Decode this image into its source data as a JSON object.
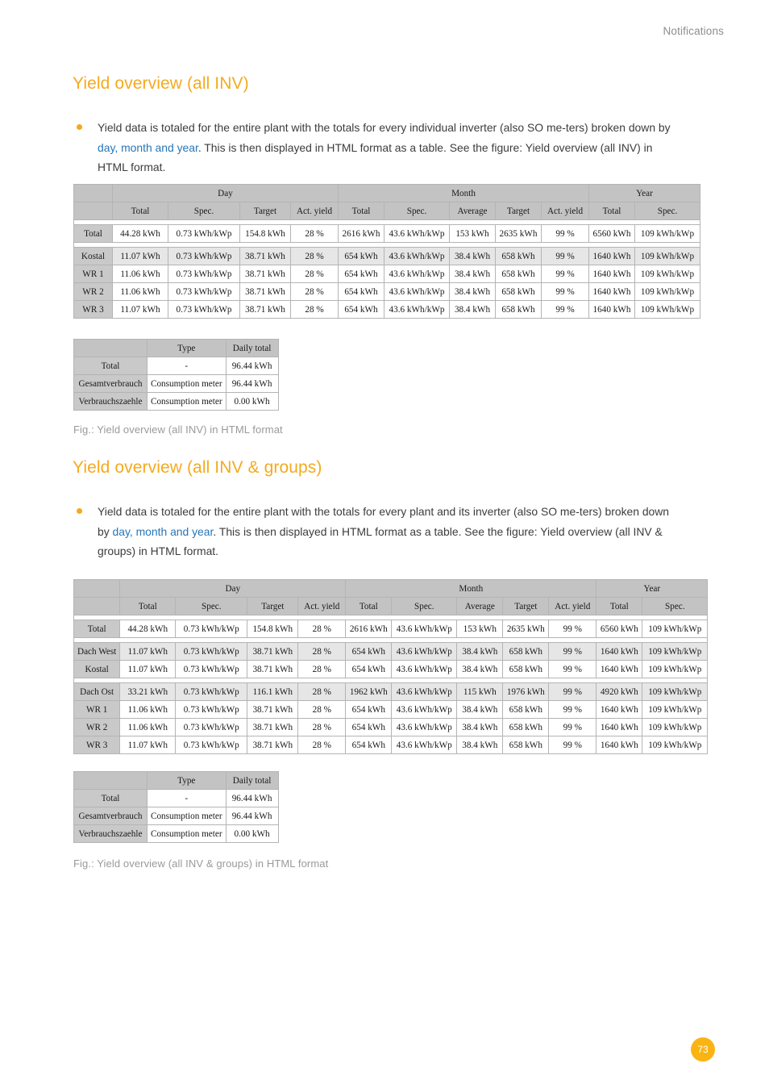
{
  "header": {
    "running_head": "Notifications"
  },
  "page_number": "73",
  "colors": {
    "accent": "#f4aa1e",
    "link": "#2676b8",
    "body_text": "#3c3c3b",
    "caption": "#9a9a9a",
    "table_header_bg": "#c3c3c3",
    "table_rowheader_bg": "#c9c9c9",
    "table_shaded_bg": "#e6e6e6"
  },
  "sections": [
    {
      "title": "Yield overview (all INV)",
      "bullet": {
        "part1": "Yield data is totaled for the entire plant with the totals for every individual inverter (also SO me-ters) broken down by ",
        "link": "day, month and year",
        "part2": ". This is then displayed in HTML format as a table. See the figure: Yield overview (all INV) in HTML format."
      },
      "caption": "Fig.: Yield overview (all INV) in HTML format"
    },
    {
      "title": "Yield overview (all INV & groups)",
      "bullet": {
        "part1": "Yield data is totaled for the entire plant with the totals for every plant and its inverter (also SO me-ters) broken down by ",
        "link": "day, month and year",
        "part2": ". This is then displayed in HTML format as a table. See the figure: Yield overview (all INV & groups) in HTML format."
      },
      "caption": "Fig.: Yield overview (all INV & groups) in HTML format"
    }
  ],
  "table1": {
    "group_headers": [
      "",
      "Day",
      "Month",
      "Year"
    ],
    "group_spans": [
      1,
      4,
      5,
      2
    ],
    "sub_headers": [
      "",
      "Total",
      "Spec.",
      "Target",
      "Act. yield",
      "Total",
      "Spec.",
      "Average",
      "Target",
      "Act. yield",
      "Total",
      "Spec."
    ],
    "rows": [
      {
        "kind": "spacer"
      },
      {
        "kind": "data",
        "shaded": false,
        "label": "Total",
        "cells": [
          "44.28 kWh",
          "0.73 kWh/kWp",
          "154.8 kWh",
          "28 %",
          "2616 kWh",
          "43.6 kWh/kWp",
          "153 kWh",
          "2635 kWh",
          "99 %",
          "6560 kWh",
          "109 kWh/kWp"
        ]
      },
      {
        "kind": "spacer"
      },
      {
        "kind": "data",
        "shaded": true,
        "label": "Kostal",
        "cells": [
          "11.07 kWh",
          "0.73 kWh/kWp",
          "38.71 kWh",
          "28 %",
          "654 kWh",
          "43.6 kWh/kWp",
          "38.4 kWh",
          "658 kWh",
          "99 %",
          "1640 kWh",
          "109 kWh/kWp"
        ]
      },
      {
        "kind": "data",
        "shaded": false,
        "label": "WR 1",
        "cells": [
          "11.06 kWh",
          "0.73 kWh/kWp",
          "38.71 kWh",
          "28 %",
          "654 kWh",
          "43.6 kWh/kWp",
          "38.4 kWh",
          "658 kWh",
          "99 %",
          "1640 kWh",
          "109 kWh/kWp"
        ]
      },
      {
        "kind": "data",
        "shaded": false,
        "label": "WR 2",
        "cells": [
          "11.06 kWh",
          "0.73 kWh/kWp",
          "38.71 kWh",
          "28 %",
          "654 kWh",
          "43.6 kWh/kWp",
          "38.4 kWh",
          "658 kWh",
          "99 %",
          "1640 kWh",
          "109 kWh/kWp"
        ]
      },
      {
        "kind": "data",
        "shaded": false,
        "label": "WR 3",
        "cells": [
          "11.07 kWh",
          "0.73 kWh/kWp",
          "38.71 kWh",
          "28 %",
          "654 kWh",
          "43.6 kWh/kWp",
          "38.4 kWh",
          "658 kWh",
          "99 %",
          "1640 kWh",
          "109 kWh/kWp"
        ]
      }
    ]
  },
  "table2": {
    "headers": [
      "",
      "Type",
      "Daily total"
    ],
    "rows": [
      {
        "label": "Total",
        "type": "-",
        "daily_total": "96.44 kWh"
      },
      {
        "label": "Gesamtverbrauch",
        "type": "Consumption meter",
        "daily_total": "96.44 kWh"
      },
      {
        "label": "Verbrauchszaehle",
        "type": "Consumption meter",
        "daily_total": "0.00 kWh"
      }
    ]
  },
  "table3": {
    "group_headers": [
      "",
      "Day",
      "Month",
      "Year"
    ],
    "group_spans": [
      1,
      4,
      5,
      2
    ],
    "sub_headers": [
      "",
      "Total",
      "Spec.",
      "Target",
      "Act. yield",
      "Total",
      "Spec.",
      "Average",
      "Target",
      "Act. yield",
      "Total",
      "Spec."
    ],
    "rows": [
      {
        "kind": "spacer"
      },
      {
        "kind": "data",
        "shaded": false,
        "label": "Total",
        "cells": [
          "44.28 kWh",
          "0.73 kWh/kWp",
          "154.8 kWh",
          "28 %",
          "2616 kWh",
          "43.6 kWh/kWp",
          "153 kWh",
          "2635 kWh",
          "99 %",
          "6560 kWh",
          "109 kWh/kWp"
        ]
      },
      {
        "kind": "spacer"
      },
      {
        "kind": "data",
        "shaded": true,
        "label": "Dach West",
        "cells": [
          "11.07 kWh",
          "0.73 kWh/kWp",
          "38.71 kWh",
          "28 %",
          "654 kWh",
          "43.6 kWh/kWp",
          "38.4 kWh",
          "658 kWh",
          "99 %",
          "1640 kWh",
          "109 kWh/kWp"
        ]
      },
      {
        "kind": "data",
        "shaded": false,
        "label": "Kostal",
        "cells": [
          "11.07 kWh",
          "0.73 kWh/kWp",
          "38.71 kWh",
          "28 %",
          "654 kWh",
          "43.6 kWh/kWp",
          "38.4 kWh",
          "658 kWh",
          "99 %",
          "1640 kWh",
          "109 kWh/kWp"
        ]
      },
      {
        "kind": "spacer"
      },
      {
        "kind": "data",
        "shaded": true,
        "label": "Dach Ost",
        "cells": [
          "33.21 kWh",
          "0.73 kWh/kWp",
          "116.1 kWh",
          "28 %",
          "1962 kWh",
          "43.6 kWh/kWp",
          "115 kWh",
          "1976 kWh",
          "99 %",
          "4920 kWh",
          "109 kWh/kWp"
        ]
      },
      {
        "kind": "data",
        "shaded": false,
        "label": "WR 1",
        "cells": [
          "11.06 kWh",
          "0.73 kWh/kWp",
          "38.71 kWh",
          "28 %",
          "654 kWh",
          "43.6 kWh/kWp",
          "38.4 kWh",
          "658 kWh",
          "99 %",
          "1640 kWh",
          "109 kWh/kWp"
        ]
      },
      {
        "kind": "data",
        "shaded": false,
        "label": "WR 2",
        "cells": [
          "11.06 kWh",
          "0.73 kWh/kWp",
          "38.71 kWh",
          "28 %",
          "654 kWh",
          "43.6 kWh/kWp",
          "38.4 kWh",
          "658 kWh",
          "99 %",
          "1640 kWh",
          "109 kWh/kWp"
        ]
      },
      {
        "kind": "data",
        "shaded": false,
        "label": "WR 3",
        "cells": [
          "11.07 kWh",
          "0.73 kWh/kWp",
          "38.71 kWh",
          "28 %",
          "654 kWh",
          "43.6 kWh/kWp",
          "38.4 kWh",
          "658 kWh",
          "99 %",
          "1640 kWh",
          "109 kWh/kWp"
        ]
      }
    ]
  },
  "table4": {
    "headers": [
      "",
      "Type",
      "Daily total"
    ],
    "rows": [
      {
        "label": "Total",
        "type": "-",
        "daily_total": "96.44 kWh"
      },
      {
        "label": "Gesamtverbrauch",
        "type": "Consumption meter",
        "daily_total": "96.44 kWh"
      },
      {
        "label": "Verbrauchszaehle",
        "type": "Consumption meter",
        "daily_total": "0.00 kWh"
      }
    ]
  }
}
